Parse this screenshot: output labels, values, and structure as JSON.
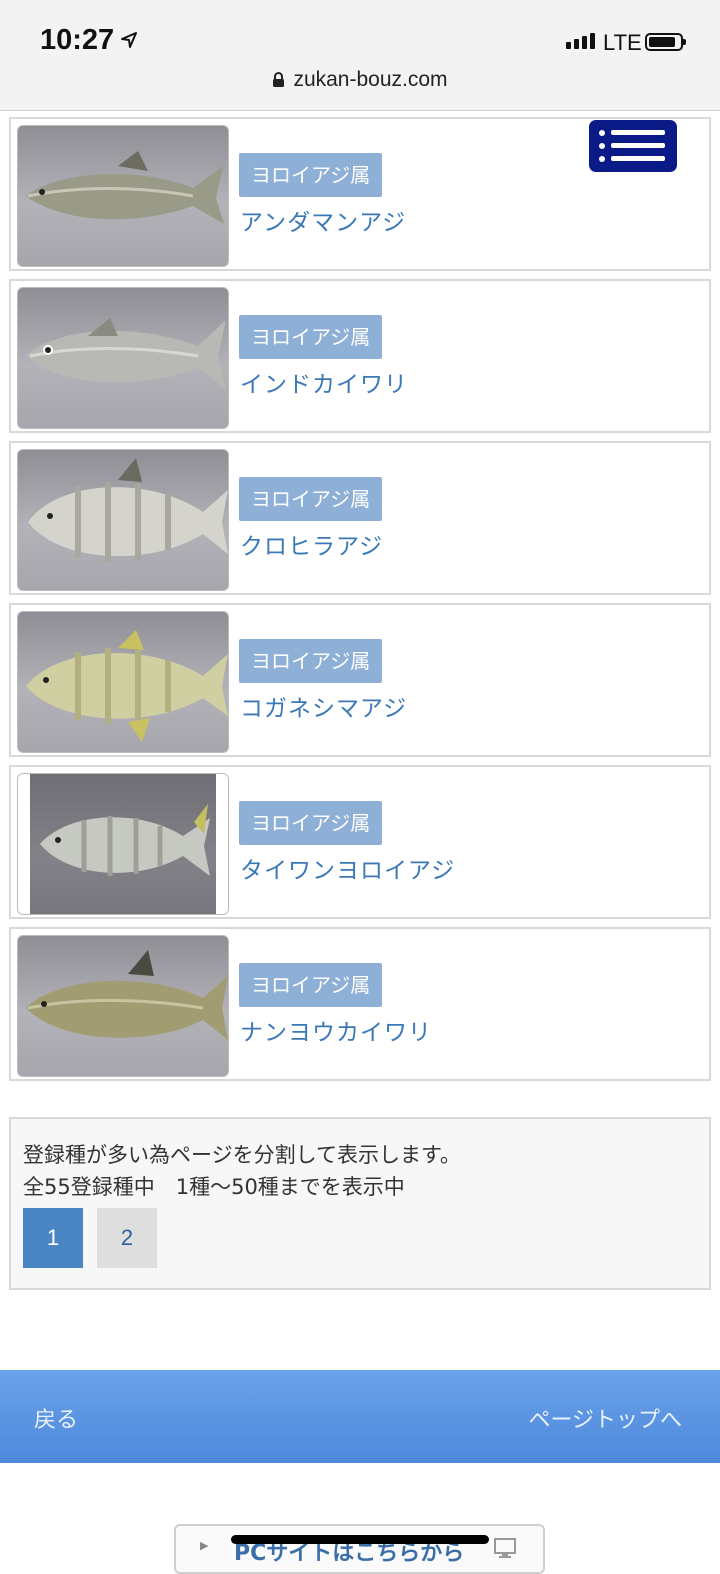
{
  "status_bar": {
    "time": "10:27",
    "network": "LTE",
    "url": "zukan-bouz.com"
  },
  "fish_list": [
    {
      "genus": "ヨロイアジ属",
      "name": "アンダマンアジ",
      "photo": "fish-photo"
    },
    {
      "genus": "ヨロイアジ属",
      "name": "インドカイワリ",
      "photo": "fish-photo"
    },
    {
      "genus": "ヨロイアジ属",
      "name": "クロヒラアジ",
      "photo": "fish-photo"
    },
    {
      "genus": "ヨロイアジ属",
      "name": "コガネシマアジ",
      "photo": "fish-photo"
    },
    {
      "genus": "ヨロイアジ属",
      "name": "タイワンヨロイアジ",
      "photo": "fish-photo"
    },
    {
      "genus": "ヨロイアジ属",
      "name": "ナンヨウカイワリ",
      "photo": "fish-photo"
    }
  ],
  "pagination": {
    "notice": "登録種が多い為ページを分割して表示します。",
    "range": "全55登録種中　1種～50種までを表示中",
    "pages": [
      "1",
      "2"
    ],
    "current_page": "1"
  },
  "footer": {
    "back_label": "戻る",
    "page_top_label": "ページトップへ"
  },
  "pc_site": {
    "label": "PCサイトはこちらから"
  },
  "colors": {
    "tag_bg": "#8fb0d6",
    "link_text": "#3a78b6",
    "menu_button": "#0a1a86",
    "footer_bar": "#5a93e0",
    "active_page": "#4a86c4"
  },
  "icons": [
    "location-arrow-icon",
    "signal-icon",
    "battery-icon",
    "lock-icon",
    "menu-icon",
    "monitor-icon"
  ]
}
